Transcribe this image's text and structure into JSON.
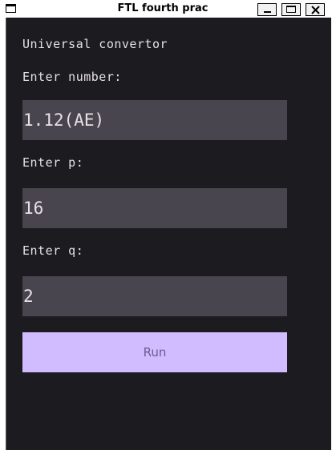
{
  "window": {
    "title": "FTL fourth prac"
  },
  "app": {
    "heading": "Universal convertor",
    "number_label": "Enter number:",
    "number_value": "1.12(AE)",
    "p_label": "Enter p:",
    "p_value": "16",
    "q_label": "Enter q:",
    "q_value": "2",
    "run_label": "Run"
  },
  "icons": {
    "app": "window-icon",
    "minimize": "minimize-icon",
    "maximize": "maximize-icon",
    "close": "close-icon"
  },
  "colors": {
    "background": "#1c1b1f",
    "field": "#49454f",
    "text": "#e6e1e5",
    "button": "#d0bcff",
    "button_text": "#6b5a8f"
  }
}
